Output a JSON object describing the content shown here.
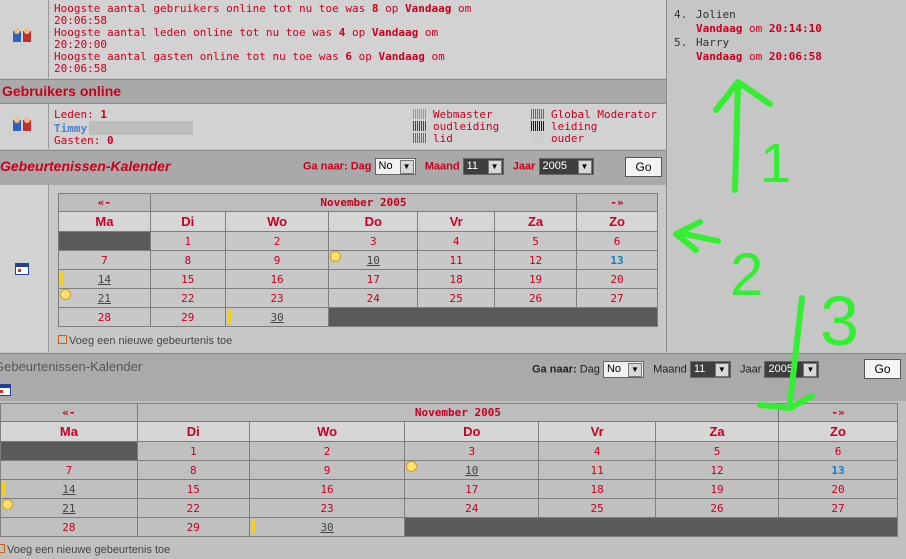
{
  "stats": {
    "line1a": "Hoogste aantal gebruikers online tot nu toe was",
    "line1_count": "8",
    "line1_op": "op",
    "line1_day": "Vandaag",
    "line1_om": "om",
    "line1_time": "20:06:58",
    "line2a": "Hoogste aantal leden online tot nu toe was",
    "line2_count": "4",
    "line2_op": "op",
    "line2_day": "Vandaag",
    "line2_om": "om",
    "line2_time": "20:20:00",
    "line3a": "Hoogste aantal gasten online tot nu toe was",
    "line3_count": "6",
    "line3_op": "op",
    "line3_day": "Vandaag",
    "line3_om": "om",
    "line3_time": "20:06:58"
  },
  "recent": [
    {
      "num": "4.",
      "name": "Jolien",
      "day": "Vandaag",
      "om": "om",
      "time": "20:14:10"
    },
    {
      "num": "5.",
      "name": "Harry",
      "day": "Vandaag",
      "om": "om",
      "time": "20:06:58"
    }
  ],
  "online": {
    "title": "Gebruikers online",
    "leden_label": "Leden:",
    "leden_count": "1",
    "member": "Timmy",
    "gasten_label": "Gasten:",
    "gasten_count": "0",
    "legend": [
      {
        "label": "Webmaster",
        "color": "#6aa0e0"
      },
      {
        "label": "Global Moderator",
        "color": "#1aa01a"
      },
      {
        "label": "oudleiding",
        "color": "#e00000"
      },
      {
        "label": "leiding",
        "color": "#0000e0"
      },
      {
        "label": "lid",
        "color": "#1aa01a"
      },
      {
        "label": "ouder",
        "color": "#f0e000"
      }
    ]
  },
  "calendar1": {
    "title": "Gebeurtenissen-Kalender",
    "goto_label": "Ga naar:",
    "dag_label": "Dag",
    "dag_value": "No",
    "maand_label": "Maand",
    "maand_value": "11",
    "jaar_label": "Jaar",
    "jaar_value": "2005",
    "go": "Go",
    "prev": "«-",
    "month": "November 2005",
    "next": "-»",
    "days": [
      "Ma",
      "Di",
      "Wo",
      "Do",
      "Vr",
      "Za",
      "Zo"
    ],
    "add_event": "Voeg een nieuwe gebeurtenis toe"
  },
  "calendar2": {
    "title": "Gebeurtenissen-Kalender",
    "goto_label": "Ga naar:",
    "dag_label": "Dag",
    "dag_value": "No",
    "maand_label": "Maand",
    "maand_value": "11",
    "jaar_label": "Jaar",
    "jaar_value": "2005",
    "go": "Go",
    "prev": "«-",
    "month": "November 2005",
    "next": "-»",
    "days": [
      "Ma",
      "Di",
      "Wo",
      "Do",
      "Vr",
      "Za",
      "Zo"
    ],
    "add_event": "Voeg een nieuwe gebeurtenis toe"
  },
  "weeks": [
    [
      "",
      "1",
      "2",
      "3",
      "4",
      "5",
      "6"
    ],
    [
      "7",
      "8",
      "9",
      "10",
      "11",
      "12",
      "13"
    ],
    [
      "14",
      "15",
      "16",
      "17",
      "18",
      "19",
      "20"
    ],
    [
      "21",
      "22",
      "23",
      "24",
      "25",
      "26",
      "27"
    ],
    [
      "28",
      "29",
      "30",
      "",
      "",
      "",
      ""
    ]
  ],
  "annotations": {
    "color": "#33ee33",
    "one": "1",
    "two": "2",
    "three": "3"
  },
  "icons": [
    "users-icon",
    "calendar-icon",
    "candle-icon",
    "sun-icon",
    "arrow-icon"
  ]
}
